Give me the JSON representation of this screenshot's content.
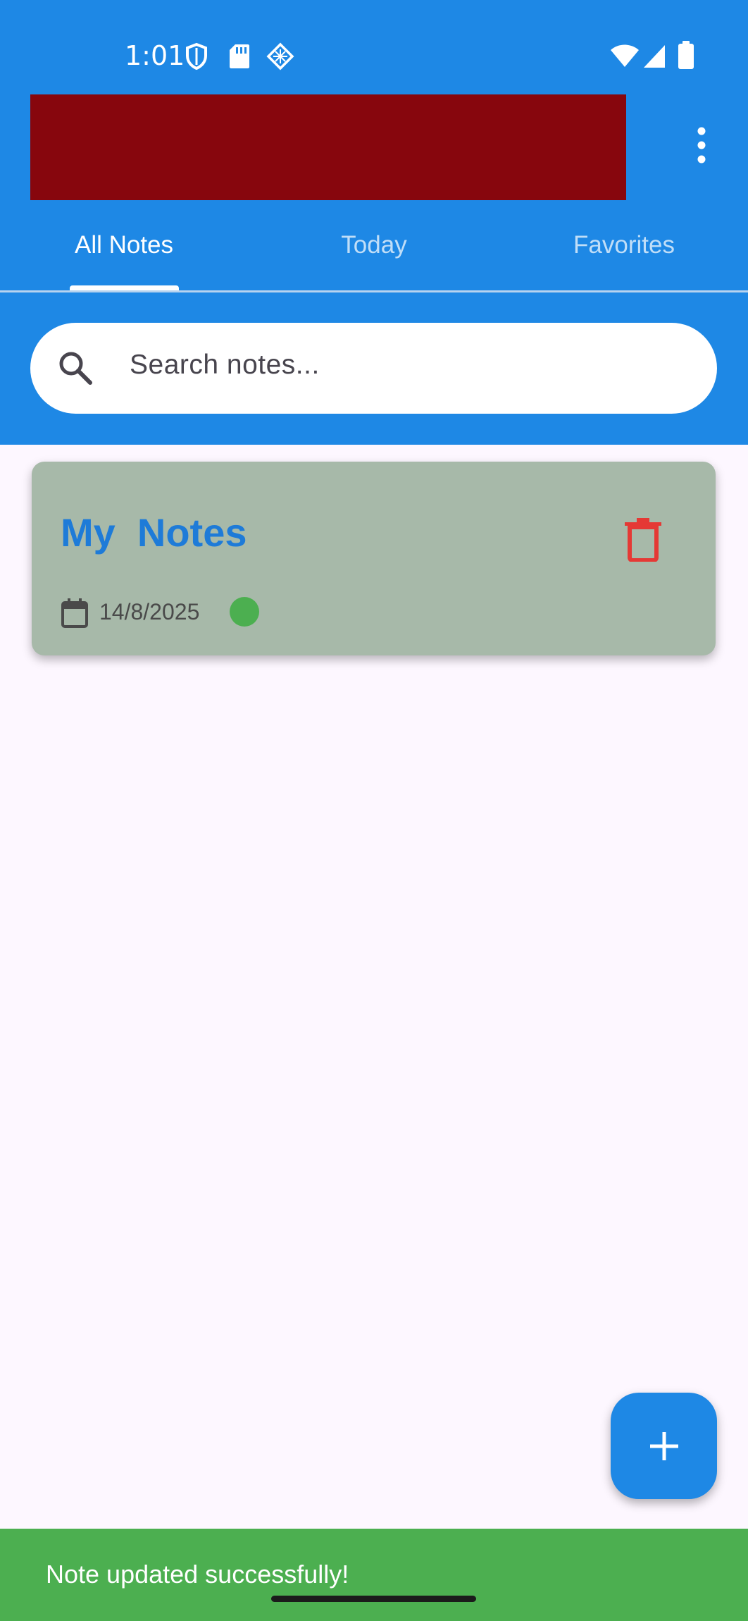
{
  "status_bar": {
    "time": "1:01",
    "left_icons": [
      "shield-icon",
      "sd-card-icon",
      "diamond-grid-icon"
    ],
    "right_icons": [
      "wifi-icon",
      "signal-icon",
      "battery-icon"
    ]
  },
  "app_bar": {
    "title_redacted": true,
    "menu_icon": "more-vert-icon"
  },
  "tabs": [
    {
      "label": "All Notes",
      "active": true
    },
    {
      "label": "Today",
      "active": false
    },
    {
      "label": "Favorites",
      "active": false
    }
  ],
  "search": {
    "placeholder": "Search notes...",
    "icon": "search-icon"
  },
  "notes": [
    {
      "title": "My  Notes",
      "date": "14/8/2025",
      "status_color": "#4caf50",
      "delete_icon": "trash-icon",
      "calendar_icon": "calendar-icon"
    }
  ],
  "fab": {
    "icon": "plus-icon"
  },
  "snackbar": {
    "message": "Note updated successfully!"
  },
  "colors": {
    "primary": "#1e88e5",
    "redacted_block": "#87060d",
    "card_background": "#a7b9a9",
    "title_blue": "#1e7bd8",
    "delete_red": "#e53935",
    "snackbar_green": "#4caf50",
    "page_background": "#fdf7ff"
  }
}
